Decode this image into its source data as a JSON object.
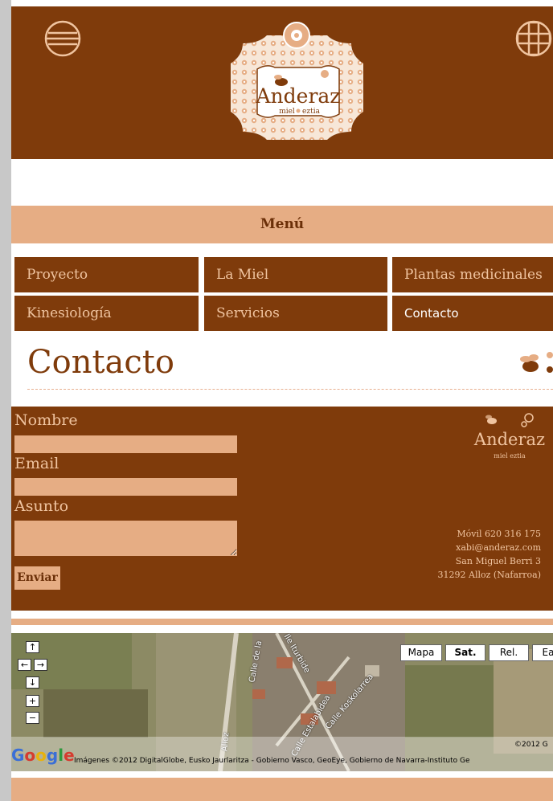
{
  "header": {
    "logo_name": "Anderaz",
    "logo_tagline_left": "miel",
    "logo_tagline_right": "eztia"
  },
  "menu": {
    "label": "Menú"
  },
  "nav": {
    "items": [
      {
        "label": "Proyecto"
      },
      {
        "label": "La Miel"
      },
      {
        "label": "Plantas medicinales"
      },
      {
        "label": "Kinesiología"
      },
      {
        "label": "Servicios"
      },
      {
        "label": "Contacto"
      }
    ]
  },
  "page": {
    "title": "Contacto"
  },
  "form": {
    "name_label": "Nombre",
    "name_value": "",
    "email_label": "Email",
    "email_value": "",
    "subject_label": "Asunto",
    "subject_value": "",
    "send_label": "Enviar"
  },
  "contact_info": {
    "logo_name": "Anderaz",
    "logo_tagline": "miel eztia",
    "mobile": "Móvil 620 316 175",
    "email": "xabi@anderaz.com",
    "street": "San Miguel Berri 3",
    "city": "31292 Alloz (Nafarroa)"
  },
  "map": {
    "type_buttons": [
      {
        "label": "Mapa"
      },
      {
        "label": "Sat."
      },
      {
        "label": "Rel."
      },
      {
        "label": "Ea"
      }
    ],
    "selected_type": "Sat.",
    "controls": {
      "up": "↑",
      "left": "←",
      "right": "→",
      "down": "↓",
      "zoom_in": "+",
      "zoom_out": "−"
    },
    "streets": [
      "Calle de la",
      "Ile Iturbide",
      "Calle Koskolarrea",
      "Calle Estalabidea",
      "Alloz"
    ],
    "google_label": "Google",
    "copyright_short": "©2012 G",
    "imagery_credit": "Imágenes ©2012 DigitalGlobe, Eusko Jaurlaritza - Gobierno Vasco, GeoEye, Gobierno de Navarra-Instituto Ge"
  },
  "colors": {
    "brown": "#7f3b0b",
    "peach": "#e6ad84",
    "text_light": "#f0c4a0"
  }
}
